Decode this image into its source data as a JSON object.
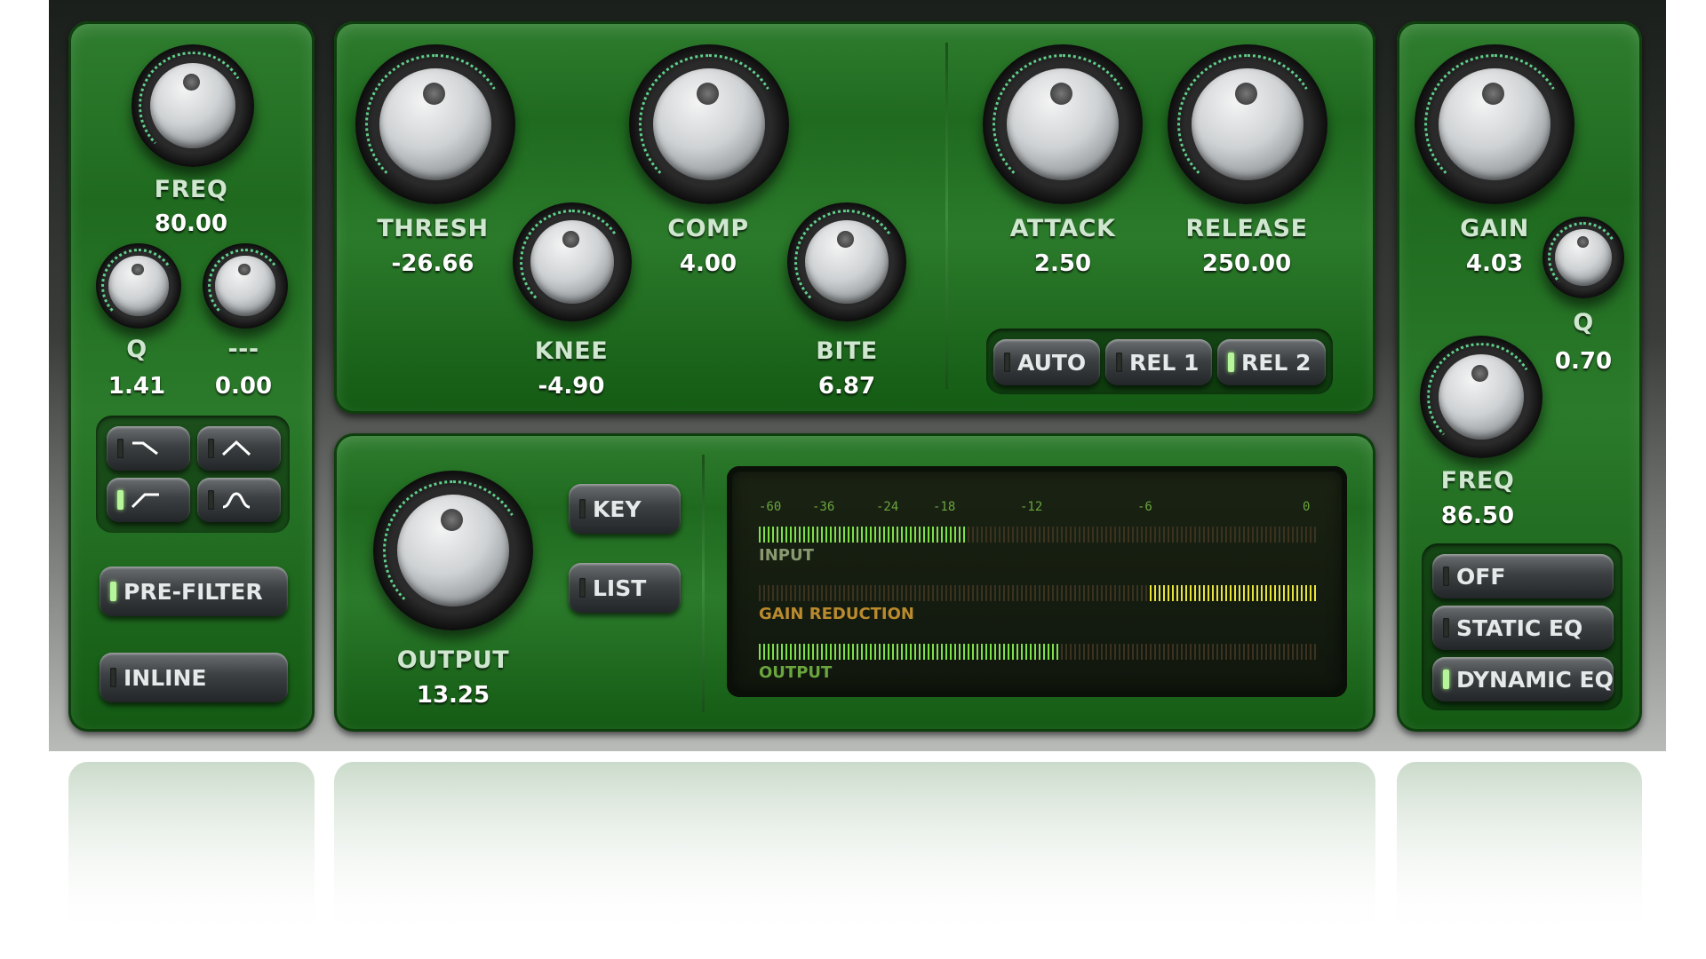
{
  "colors": {
    "panel_green": "#2b7a2b",
    "led_on": "#b6f59a",
    "meter_green": "#7ee04a",
    "meter_yellow": "#e8e43a",
    "label": "#cfe6cf",
    "value": "#ffffff"
  },
  "left": {
    "freq": {
      "label": "FREQ",
      "value": "80.00"
    },
    "q": {
      "label": "Q",
      "value": "1.41"
    },
    "gain": {
      "label": "---",
      "value": "0.00"
    },
    "filter_shapes": [
      {
        "icon": "high-shelf-icon",
        "selected": false
      },
      {
        "icon": "peak-icon",
        "selected": false
      },
      {
        "icon": "low-shelf-icon",
        "selected": true
      },
      {
        "icon": "notch-icon",
        "selected": false
      }
    ],
    "prefilter": {
      "label": "PRE-FILTER",
      "on": true
    },
    "inline": {
      "label": "INLINE",
      "on": false
    }
  },
  "compressor": {
    "thresh": {
      "label": "THRESH",
      "value": "-26.66"
    },
    "knee": {
      "label": "KNEE",
      "value": "-4.90"
    },
    "comp": {
      "label": "COMP",
      "value": "4.00"
    },
    "bite": {
      "label": "BITE",
      "value": "6.87"
    },
    "attack": {
      "label": "ATTACK",
      "value": "2.50"
    },
    "release": {
      "label": "RELEASE",
      "value": "250.00"
    },
    "release_modes": [
      {
        "label": "AUTO",
        "on": false
      },
      {
        "label": "REL 1",
        "on": false
      },
      {
        "label": "REL 2",
        "on": true
      }
    ]
  },
  "output_section": {
    "output": {
      "label": "OUTPUT",
      "value": "13.25"
    },
    "key": {
      "label": "KEY",
      "on": false
    },
    "list": {
      "label": "LIST",
      "on": false
    }
  },
  "meter": {
    "scale": [
      "-60",
      "-36",
      "-24",
      "-18",
      "-12",
      "-6",
      "0"
    ],
    "input": {
      "label": "INPUT",
      "level": 0.37
    },
    "gain_reduction": {
      "label": "GAIN REDUCTION",
      "level": 0.3
    },
    "output": {
      "label": "OUTPUT",
      "level": 0.54
    }
  },
  "right": {
    "gain": {
      "label": "GAIN",
      "value": "4.03"
    },
    "q": {
      "label": "Q",
      "value": "0.70"
    },
    "freq": {
      "label": "FREQ",
      "value": "86.50"
    },
    "eq_modes": [
      {
        "label": "OFF",
        "on": false
      },
      {
        "label": "STATIC EQ",
        "on": false
      },
      {
        "label": "DYNAMIC EQ",
        "on": true
      }
    ]
  }
}
